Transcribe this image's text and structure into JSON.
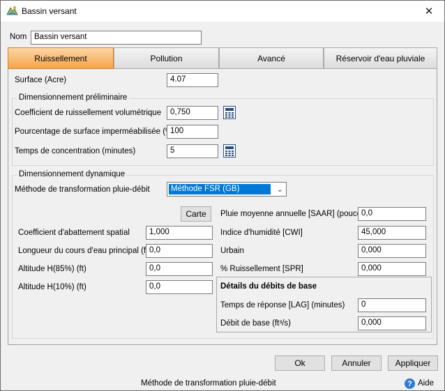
{
  "window": {
    "title": "Bassin versant",
    "close_symbol": "✕"
  },
  "name_field": {
    "label": "Nom",
    "value": "Bassin versant"
  },
  "tabs": [
    {
      "label": "Ruissellement",
      "active": true
    },
    {
      "label": "Pollution",
      "active": false
    },
    {
      "label": "Avancé",
      "active": false
    },
    {
      "label": "Réservoir d'eau pluviale",
      "active": false
    }
  ],
  "surface": {
    "label": "Surface (Acre)",
    "value": "4.07"
  },
  "prelim": {
    "title": "Dimensionnement préliminaire",
    "runoff_coef": {
      "label": "Coefficient de ruissellement volumétrique",
      "value": "0,750"
    },
    "impervious": {
      "label": "Pourcentage de surface imperméabilisée (%)",
      "value": "100"
    },
    "tc": {
      "label": "Temps de concentration (minutes)",
      "value": "5"
    }
  },
  "dynamic": {
    "title": "Dimensionnement dynamique",
    "method": {
      "label": "Méthode de transformation pluie-débit",
      "value": "Méthode FSR (GB)"
    },
    "map_button": "Carte",
    "left": {
      "abatement": {
        "label": "Coefficient d'abattement spatial",
        "value": "1,000"
      },
      "length": {
        "label": "Longueur du cours d'eau principal (ft)",
        "value": "0,0"
      },
      "alt85": {
        "label": "Altitude H(85%) (ft)",
        "value": "0,0"
      },
      "alt10": {
        "label": "Altitude H(10%) (ft)",
        "value": "0,0"
      }
    },
    "right": {
      "saar": {
        "label": "Pluie moyenne annuelle [SAAR] (pouce)",
        "value": "0,0"
      },
      "cwi": {
        "label": "Indice d'humidité [CWI]",
        "value": "45,000"
      },
      "urban": {
        "label": "Urbain",
        "value": "0,000"
      },
      "spr": {
        "label": "% Ruissellement [SPR]",
        "value": "0,000"
      }
    },
    "base_flow": {
      "title": "Détails du débits de base",
      "lag": {
        "label": "Temps de réponse [LAG] (minutes)",
        "value": "0"
      },
      "base": {
        "label": "Débit de base (ft³/s)",
        "value": "0,000"
      }
    }
  },
  "buttons": {
    "ok": "Ok",
    "cancel": "Annuler",
    "apply": "Appliquer"
  },
  "status": {
    "text": "Méthode de transformation pluie-débit",
    "help": "Aide"
  },
  "colors": {
    "active_tab": "#f6a44a",
    "selection": "#0078d7"
  }
}
